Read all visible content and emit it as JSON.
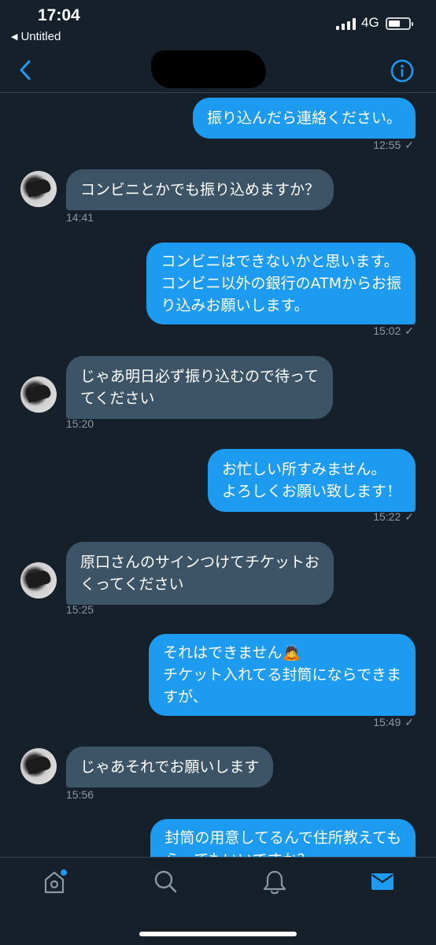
{
  "status_bar": {
    "time": "17:04",
    "back_app_label": "Untitled",
    "network": "4G"
  },
  "header": {
    "back_icon": "chevron-left-icon",
    "info_icon": "info-circle-icon"
  },
  "messages": [
    {
      "direction": "out",
      "lines": [
        "振り込んだら連絡ください。"
      ],
      "time": "12:55",
      "read_mark": "✓"
    },
    {
      "direction": "in",
      "lines": [
        "コンビニとかでも振り込めますか？"
      ],
      "time": "14:41"
    },
    {
      "direction": "out",
      "lines": [
        "コンビニはできないかと思います。",
        "コンビニ以外の銀行のATMからお振",
        "り込みお願いします。"
      ],
      "time": "15:02",
      "read_mark": "✓"
    },
    {
      "direction": "in",
      "lines": [
        "じゃあ明日必ず振り込むので待って",
        "てください"
      ],
      "time": "15:20"
    },
    {
      "direction": "out",
      "lines": [
        "お忙しい所すみません。",
        "よろしくお願い致します！"
      ],
      "time": "15:22",
      "read_mark": "✓"
    },
    {
      "direction": "in",
      "lines": [
        "原口さんのサインつけてチケットお",
        "くってください"
      ],
      "time": "15:25"
    },
    {
      "direction": "out",
      "lines": [
        "それはできません🙇",
        "チケット入れてる封筒にならできま",
        "すが、"
      ],
      "time": "15:49",
      "read_mark": "✓"
    },
    {
      "direction": "in",
      "lines": [
        "じゃあそれでお願いします"
      ],
      "time": "15:56"
    },
    {
      "direction": "out",
      "lines": [
        "封筒の用意してるんで住所教えても",
        "らってもいいですか？"
      ]
    }
  ],
  "bottom_nav": {
    "items": [
      "home-icon",
      "search-icon",
      "notifications-bell-icon",
      "messages-mail-icon"
    ],
    "active": "messages-mail-icon",
    "accent": "#1d9bf0"
  },
  "colors": {
    "background": "#15202b",
    "outgoing_bubble": "#1d9bf0",
    "incoming_bubble": "#3d5466",
    "timestamp": "#8b98a5"
  }
}
